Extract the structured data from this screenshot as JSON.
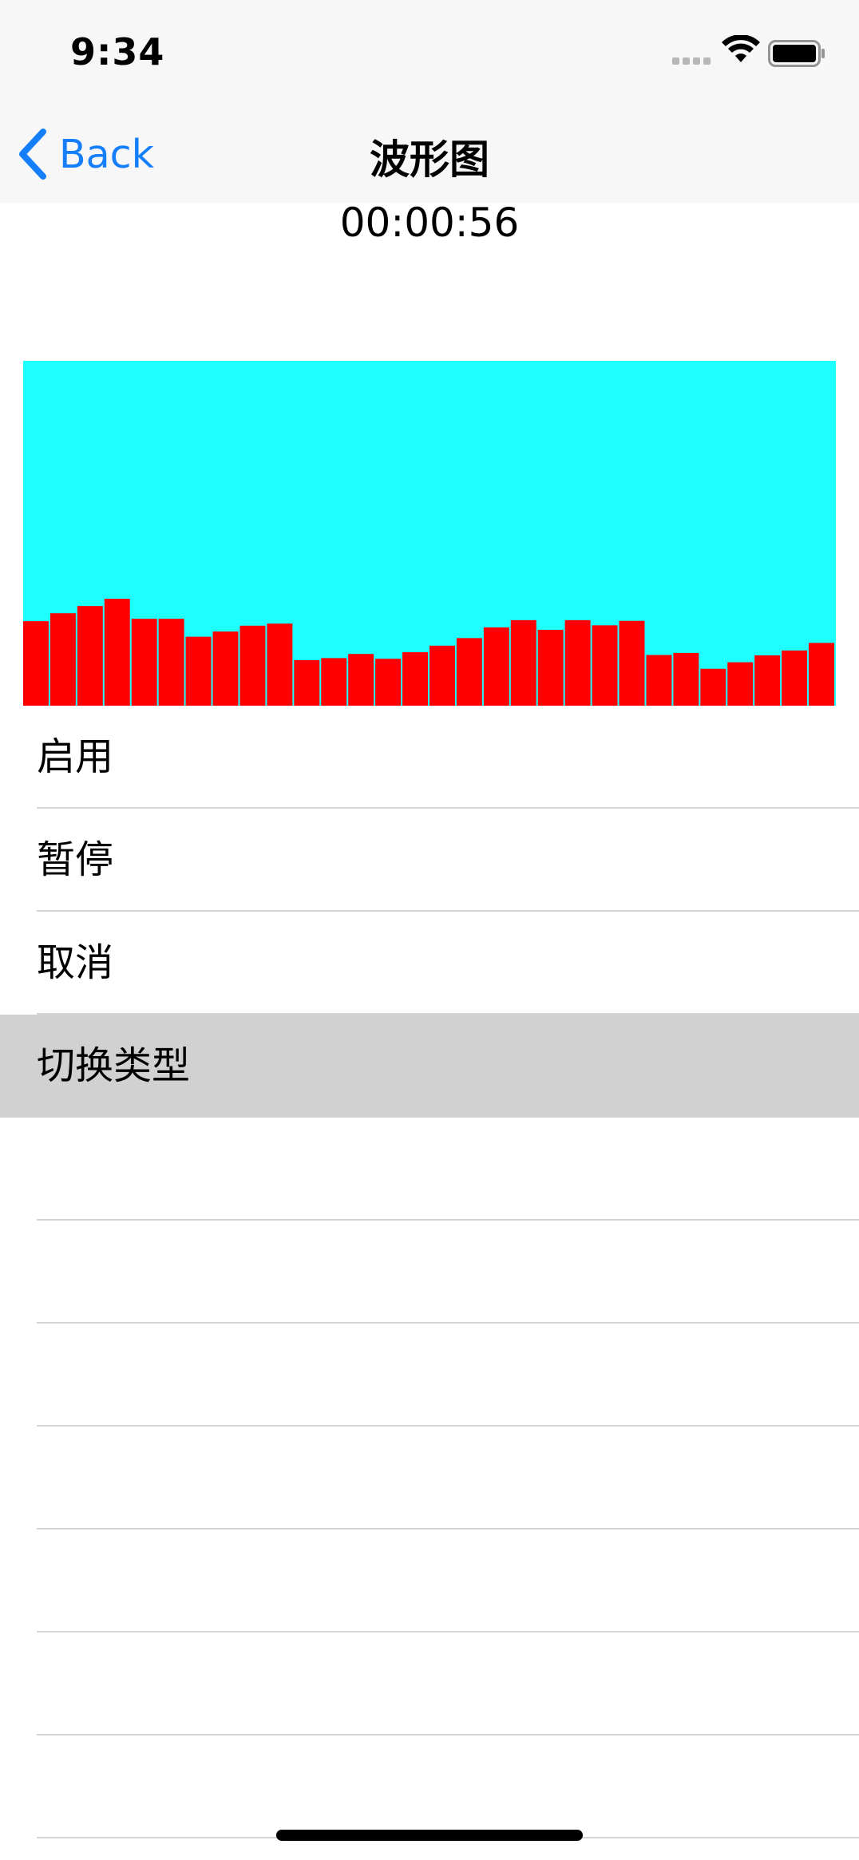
{
  "status_bar": {
    "time": "9:34",
    "icons": [
      "cellular-signal-icon",
      "wifi-icon",
      "battery-icon"
    ]
  },
  "nav": {
    "back_label": "Back",
    "title": "波形图"
  },
  "timer": "00:00:56",
  "menu": {
    "items": [
      {
        "label": "启用"
      },
      {
        "label": "暂停"
      },
      {
        "label": "取消"
      },
      {
        "label": "切换类型",
        "selected": true
      },
      {
        "label": ""
      },
      {
        "label": ""
      },
      {
        "label": ""
      },
      {
        "label": ""
      },
      {
        "label": ""
      },
      {
        "label": ""
      },
      {
        "label": ""
      }
    ]
  },
  "colors": {
    "accent": "#147efb",
    "waveform_background": "#1effff",
    "waveform_bar": "#ff0000",
    "selected_row": "#d1d1d1"
  },
  "chart_data": {
    "type": "bar",
    "title": "",
    "xlabel": "",
    "ylabel": "",
    "ylim": [
      0,
      1
    ],
    "categories": [],
    "values": [
      0.245,
      0.268,
      0.289,
      0.31,
      0.252,
      0.252,
      0.2,
      0.215,
      0.232,
      0.238,
      0.132,
      0.138,
      0.15,
      0.136,
      0.155,
      0.174,
      0.196,
      0.227,
      0.248,
      0.22,
      0.248,
      0.233,
      0.246,
      0.147,
      0.153,
      0.107,
      0.126,
      0.146,
      0.16,
      0.182
    ]
  }
}
